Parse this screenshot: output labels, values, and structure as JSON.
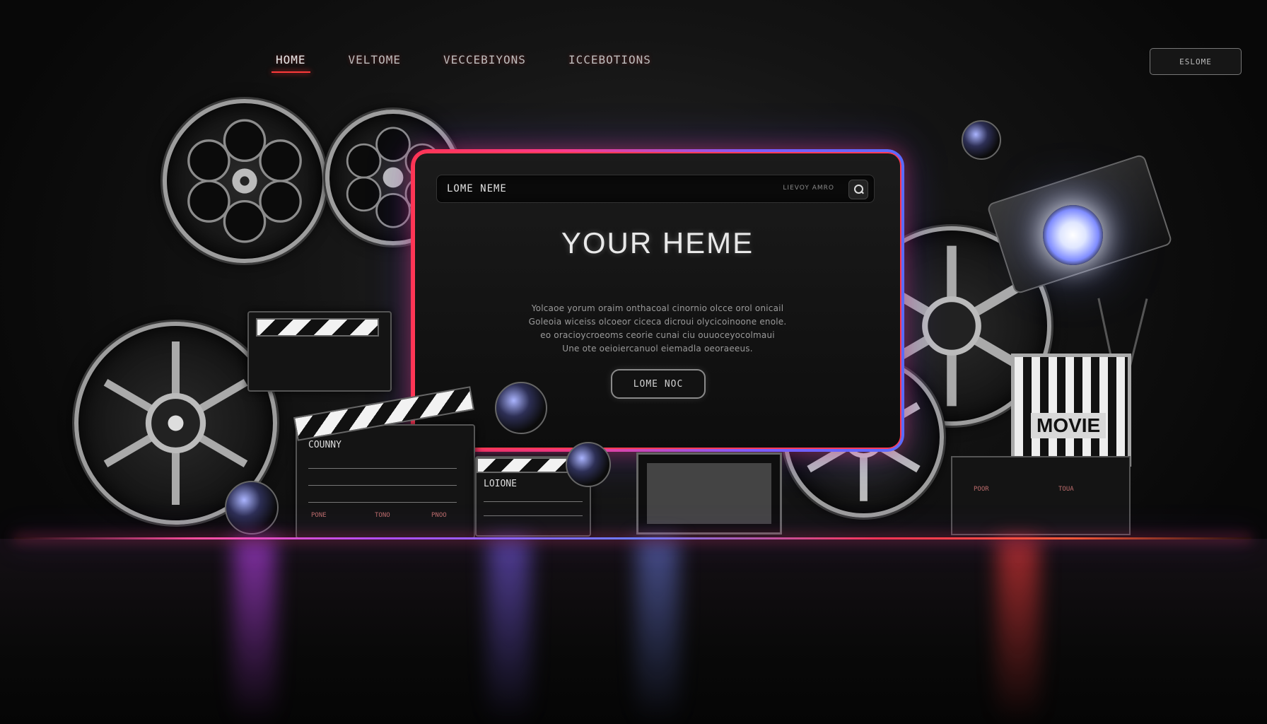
{
  "nav": {
    "items": [
      {
        "label": "HOME",
        "active": true
      },
      {
        "label": "VELTOME",
        "active": false
      },
      {
        "label": "VECCEBIYONS",
        "active": false
      },
      {
        "label": "ICCEBOTIONS",
        "active": false
      }
    ],
    "cta_label": "ESLOME"
  },
  "hero": {
    "search_title": "LOME NEME",
    "search_hint": "LIEVOY AMRO",
    "title": "YOUR HEME",
    "body_lines": [
      "Yolcaoe yorum oraim onthacoal cinornio olcce orol onicail",
      "Goleoia wiceiss olcoeor ciceca dicroui olycicoinoone enole.",
      "eo oracioycroeoms ceorie cunai ciu ouuoceyocolmaui",
      "Une ote oeioiercanuol eiemadla oeoraeeus."
    ],
    "button_label": "LOME NOC"
  },
  "props": {
    "clapper_label_1": "COUNNY",
    "clapper_label_2": "LOIONE",
    "movie_sign": "MOVIE",
    "small_labels": [
      "PONE",
      "TONO",
      "PNOO",
      "POOR",
      "TOUA"
    ]
  },
  "colors": {
    "accent_red": "#ff3b55",
    "accent_purple": "#7a5cff",
    "accent_blue": "#5a6bff",
    "background": "#070707"
  }
}
